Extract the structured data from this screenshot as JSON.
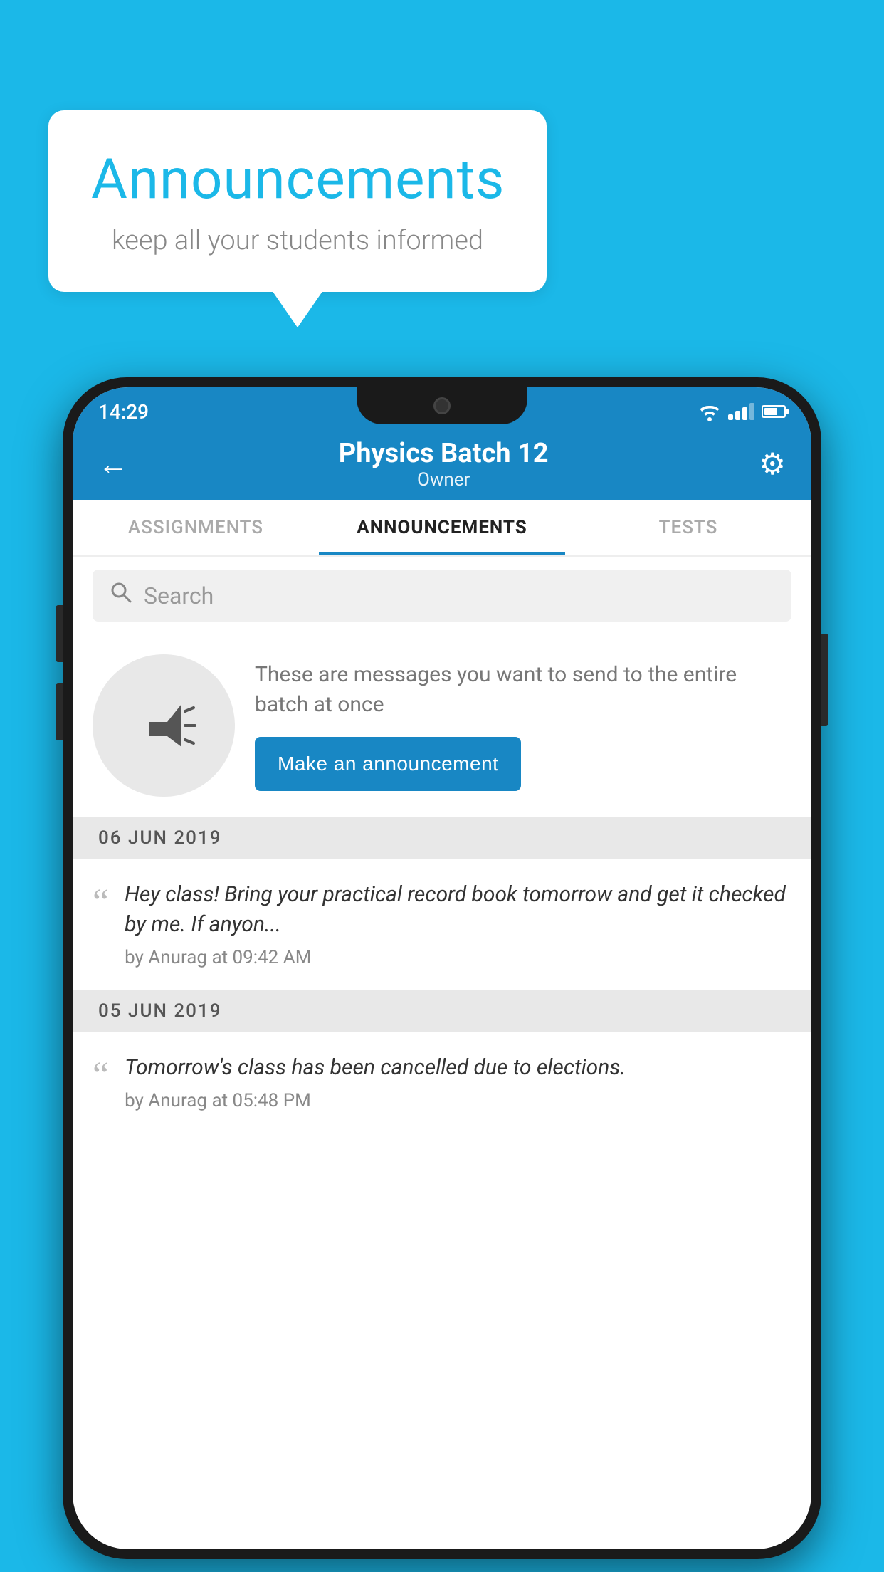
{
  "background_color": "#1BB8E8",
  "speech_bubble": {
    "title": "Announcements",
    "subtitle": "keep all your students informed"
  },
  "phone": {
    "status_bar": {
      "time": "14:29"
    },
    "header": {
      "title": "Physics Batch 12",
      "subtitle": "Owner",
      "back_label": "←",
      "settings_label": "⚙"
    },
    "tabs": [
      {
        "label": "ASSIGNMENTS",
        "active": false
      },
      {
        "label": "ANNOUNCEMENTS",
        "active": true
      },
      {
        "label": "TESTS",
        "active": false
      }
    ],
    "search": {
      "placeholder": "Search"
    },
    "intro_card": {
      "description": "These are messages you want to send to the entire batch at once",
      "button_label": "Make an announcement"
    },
    "announcements": [
      {
        "date": "06  JUN  2019",
        "items": [
          {
            "text": "Hey class! Bring your practical record book tomorrow and get it checked by me. If anyon...",
            "meta": "by Anurag at 09:42 AM"
          }
        ]
      },
      {
        "date": "05  JUN  2019",
        "items": [
          {
            "text": "Tomorrow's class has been cancelled due to elections.",
            "meta": "by Anurag at 05:48 PM"
          }
        ]
      }
    ]
  }
}
